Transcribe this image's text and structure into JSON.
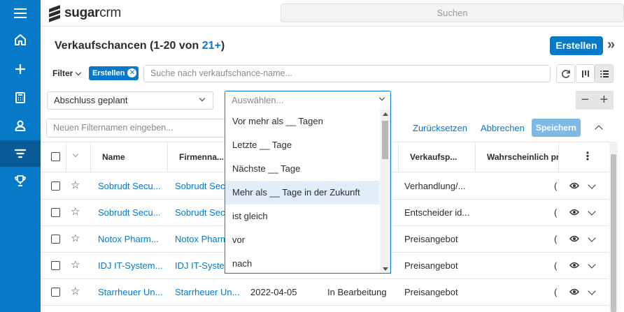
{
  "app": {
    "logo_bold": "sugar",
    "logo_thin": "crm"
  },
  "global_search": {
    "placeholder": "Suchen"
  },
  "sidebar": {
    "items": [
      {
        "icon": "home-icon"
      },
      {
        "icon": "plus-icon"
      },
      {
        "icon": "calculator-icon"
      },
      {
        "icon": "user-icon"
      },
      {
        "icon": "filter-icon",
        "active": true
      },
      {
        "icon": "trophy-icon"
      }
    ]
  },
  "header": {
    "title": "Verkaufschancen (1-20 von ",
    "count": "21+",
    "title_close": ")",
    "create_label": "Erstellen",
    "collapse_glyph": "»"
  },
  "filter": {
    "label": "Filter",
    "pill_label": "Erstellen",
    "search_placeholder": "Suche nach verkaufschance-name...",
    "field_value": "Abschluss geplant",
    "operator_placeholder": "Auswählen...",
    "name_placeholder": "Neuen Filternamen eingeben...",
    "reset_label": "Zurücksetzen",
    "cancel_label": "Abbrechen",
    "save_label": "Speichern",
    "remove_glyph": "−",
    "add_glyph": "+"
  },
  "dropdown": {
    "options": [
      "Vor mehr als __ Tagen",
      "Letzte __ Tage",
      "Nächste __ Tage",
      "Mehr als __ Tage in der Zukunft",
      "ist gleich",
      "vor",
      "nach"
    ],
    "highlighted_index": 3
  },
  "table": {
    "columns": [
      "Name",
      "Firmenna...",
      "Verkaufsp...",
      "Wahrscheinlich pro"
    ],
    "rows": [
      {
        "name": "Sobrudt Secu...",
        "company": "Sobrudt Secu",
        "date": "",
        "status": "",
        "stage": "Verhandlung/...",
        "prob": "("
      },
      {
        "name": "Sobrudt Secu...",
        "company": "Sobrudt Secu",
        "date": "",
        "status": "",
        "stage": "Entscheider id...",
        "prob": "("
      },
      {
        "name": "Notox Pharm...",
        "company": "Notox Pharm",
        "date": "",
        "status": "",
        "stage": "Preisangebot",
        "prob": "("
      },
      {
        "name": "IDJ IT-System...",
        "company": "IDJ IT-Syster",
        "date": "",
        "status": "",
        "stage": "Preisangebot",
        "prob": "("
      },
      {
        "name": "Starrheuer Un...",
        "company": "Starrheuer Un...",
        "date": "2022-04-05",
        "status": "In Bearbeitung",
        "stage": "Preisangebot",
        "prob": "("
      }
    ]
  },
  "colors": {
    "accent": "#0679c8",
    "sidebar_active": "#0a5c99",
    "highlight": "#e1eefa"
  }
}
